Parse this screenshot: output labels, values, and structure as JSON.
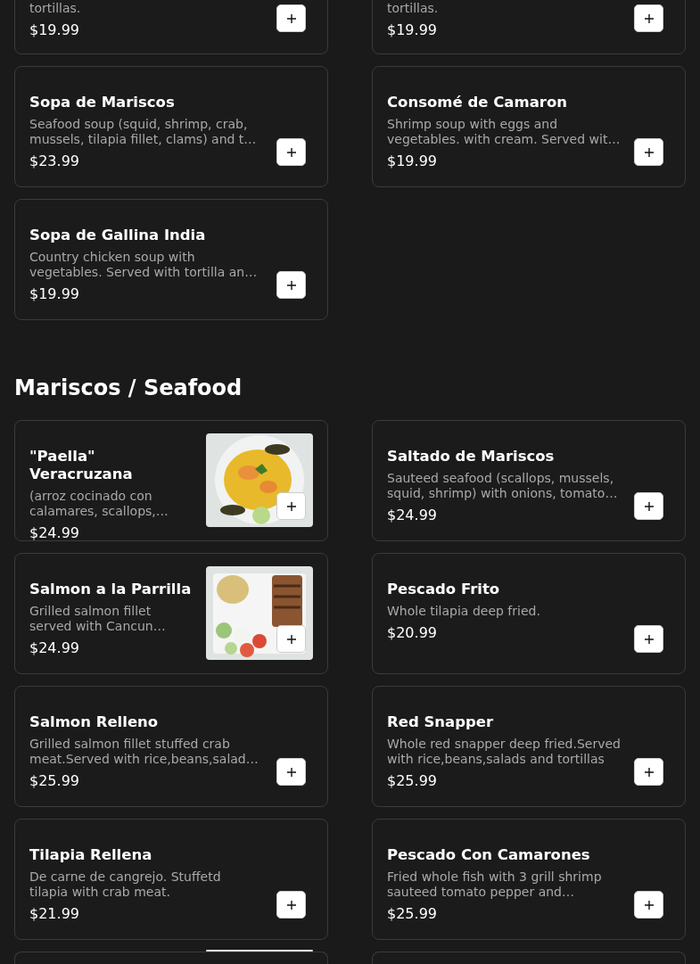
{
  "top_items": [
    {
      "kind": "cut_top",
      "description": "tortillas.",
      "price": "$19.99"
    },
    {
      "kind": "cut_top",
      "description": "tortillas.",
      "price": "$19.99"
    },
    {
      "kind": "full",
      "name": "Sopa de Mariscos",
      "description": "Seafood soup (squid, shrimp, crab, mussels, tilapia fillet, clams) and t…",
      "price": "$23.99"
    },
    {
      "kind": "full",
      "name": "Consomé de Camaron",
      "description": "Shrimp soup with eggs and vegetables. with cream. Served wit…",
      "price": "$19.99"
    },
    {
      "kind": "full",
      "name": "Sopa de Gallina India",
      "description": "Country chicken soup with vegetables. Served with tortilla an…",
      "price": "$19.99"
    }
  ],
  "sections": [
    {
      "heading": "Mariscos / Seafood",
      "items": [
        {
          "kind": "full",
          "name": "\"Paella\" Veracruzana",
          "description": "(arroz cocinado con calamares, scallops,…",
          "price": "$24.99"
        },
        {
          "kind": "full",
          "name": "Saltado de Mariscos",
          "description": "Sauteed seafood (scallops, mussels, squid, shrimp) with onions, tomato…",
          "price": "$24.99"
        },
        {
          "kind": "full",
          "name": "Salmon a la Parrilla",
          "description": "Grilled salmon fillet served with Cancun…",
          "price": "$24.99"
        },
        {
          "kind": "full",
          "name": "Pescado Frito",
          "description": "Whole tilapia deep fried.",
          "price": "$20.99"
        },
        {
          "kind": "full",
          "name": "Salmon Relleno",
          "description": "Grilled salmon fillet stuffed crab meat.Served with rice,beans,salad…",
          "price": "$25.99"
        },
        {
          "kind": "full",
          "name": "Red Snapper",
          "description": "Whole red snapper deep fried.Served with rice,beans,salads and tortillas",
          "price": "$25.99"
        },
        {
          "kind": "full",
          "name": "Tilapia Rellena",
          "description": "De carne de cangrejo. Stuffetd tilapia with crab meat.",
          "price": "$21.99"
        },
        {
          "kind": "full",
          "name": "Pescado Con Camarones",
          "description": "Fried whole fish with 3 grill shrimp sauteed tomato pepper and…",
          "price": "$25.99"
        },
        {
          "kind": "cut_bottom"
        },
        {
          "kind": "cut_bottom"
        }
      ]
    }
  ]
}
